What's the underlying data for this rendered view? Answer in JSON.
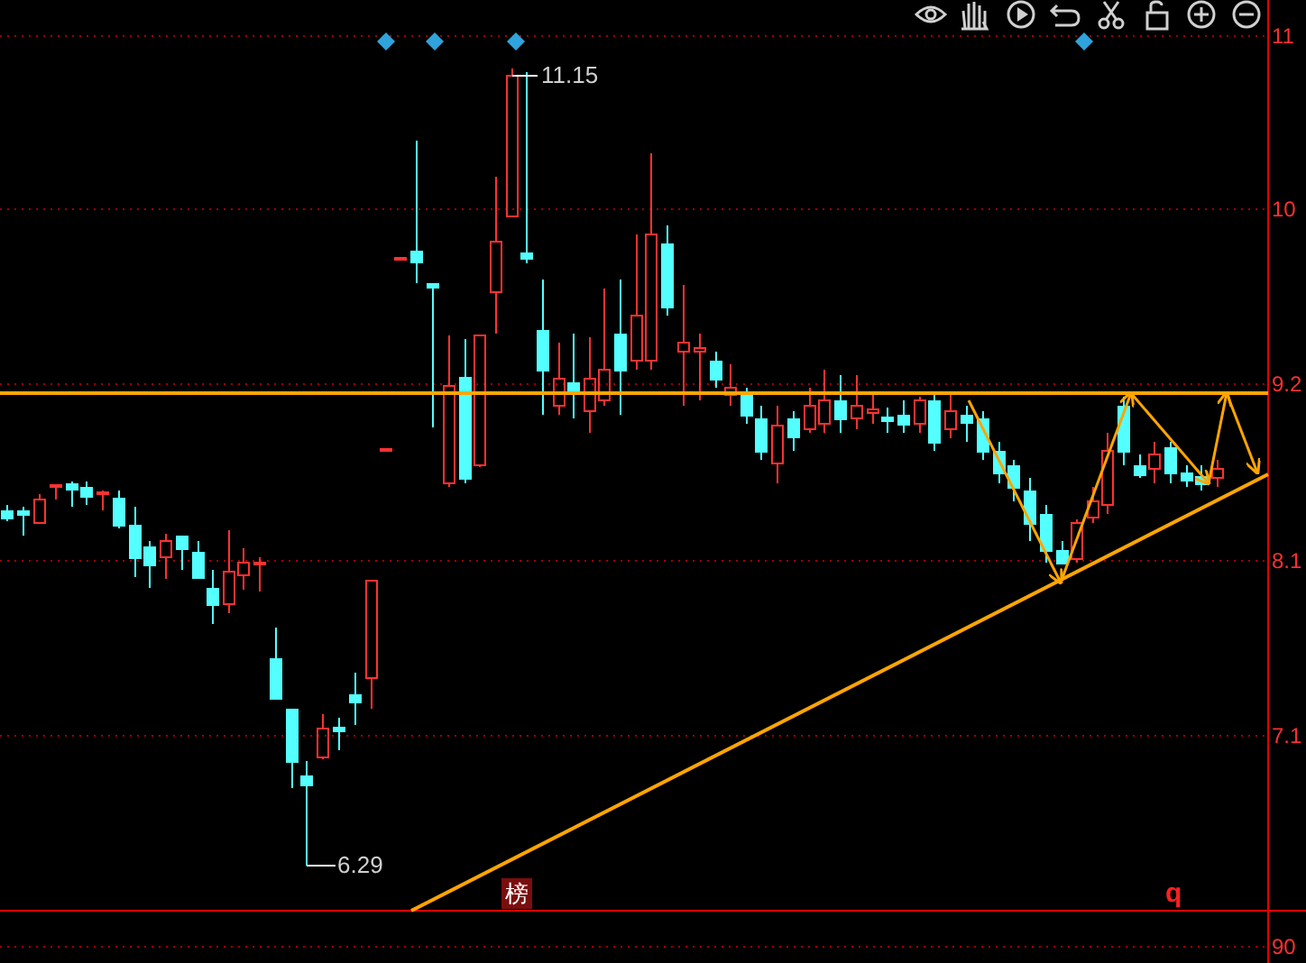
{
  "price_axis": {
    "labels": [
      "11",
      "10",
      "9.2",
      "8.1",
      "7.1",
      "90"
    ]
  },
  "price_labels": [
    {
      "kind": "high",
      "text": "11.15"
    },
    {
      "kind": "low",
      "text": "6.29"
    }
  ],
  "badge": {
    "text": "榜"
  },
  "marker": {
    "text": "q"
  }
}
